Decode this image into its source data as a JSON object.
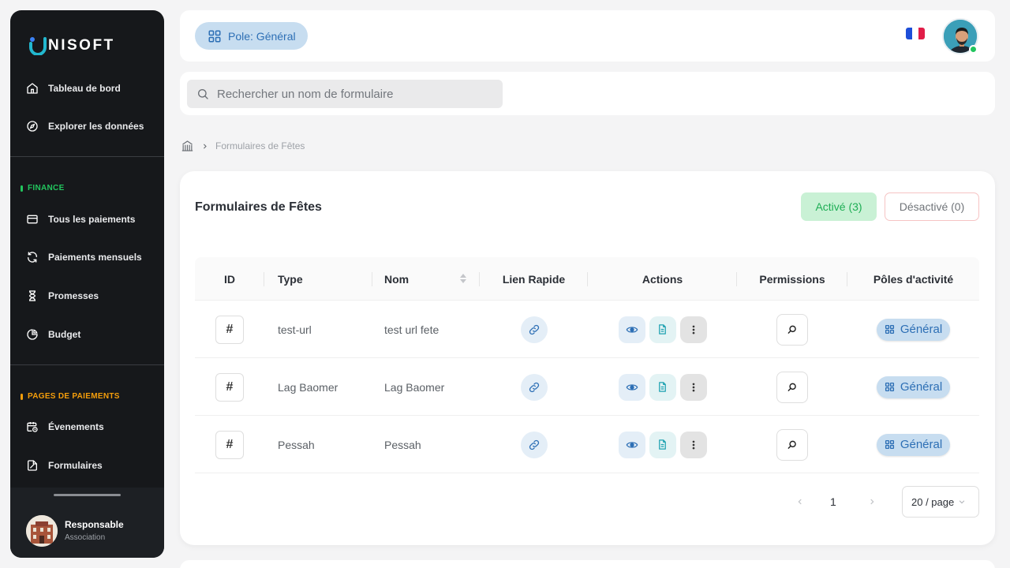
{
  "brand": {
    "logo_text": "NISOFT"
  },
  "sidebar": {
    "items": [
      {
        "label": "Tableau de bord",
        "icon": "home-icon"
      },
      {
        "label": "Explorer les données",
        "icon": "compass-icon"
      }
    ],
    "sections": [
      {
        "label": "FINANCE",
        "color": "#22c55e",
        "items": [
          {
            "label": "Tous les paiements",
            "icon": "credit-card-icon"
          },
          {
            "label": "Paiements mensuels",
            "icon": "refresh-icon"
          },
          {
            "label": "Promesses",
            "icon": "hourglass-icon"
          },
          {
            "label": "Budget",
            "icon": "pie-chart-icon"
          }
        ]
      },
      {
        "label": "PAGES DE PAIEMENTS",
        "color": "#f59e0b",
        "items": [
          {
            "label": "Évenements",
            "icon": "calendar-clock-icon"
          },
          {
            "label": "Formulaires",
            "icon": "file-signature-icon"
          }
        ]
      }
    ],
    "user": {
      "name": "Responsable",
      "role": "Association"
    }
  },
  "header": {
    "pole_label": "Pole: Général",
    "language": "fr",
    "flag_colors": [
      "#1d4ed8",
      "#ffffff",
      "#e11d48"
    ]
  },
  "search": {
    "placeholder": "Rechercher un nom de formulaire"
  },
  "breadcrumb": {
    "current": "Formulaires de Fêtes"
  },
  "card": {
    "title": "Formulaires de Fêtes",
    "filter_active": "Activé (3)",
    "filter_inactive": "Désactivé (0)"
  },
  "table": {
    "columns": {
      "id": "ID",
      "type": "Type",
      "nom": "Nom",
      "lien": "Lien Rapide",
      "actions": "Actions",
      "permissions": "Permissions",
      "poles": "Pôles d'activité"
    },
    "rows": [
      {
        "id_icon": "#",
        "type": "test-url",
        "nom": "test url fete",
        "pole": "Général"
      },
      {
        "id_icon": "#",
        "type": "Lag Baomer",
        "nom": "Lag Baomer",
        "pole": "Général"
      },
      {
        "id_icon": "#",
        "type": "Pessah",
        "nom": "Pessah",
        "pole": "Général"
      }
    ]
  },
  "pagination": {
    "current_page": "1",
    "page_size": "20 / page"
  },
  "colors": {
    "accent_blue": "#2d6fb5",
    "active_green": "#1eae55",
    "sidebar_bg": "#16181b"
  }
}
